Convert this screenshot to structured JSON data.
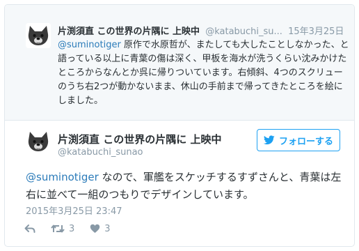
{
  "parent_tweet": {
    "name": "片渕須直 この世界の片隅に 上映中",
    "handle": "@katabuchi_su...",
    "date": "15年3月25日",
    "mention": "@suminotiger",
    "text": " 原作で水原哲が、またしても大したことしなかった、と語っている以上に青葉の傷は深く、甲板を海水が洗うくらい沈みかけたところからなんとか呉に帰りついています。右傾斜、4つのスクリューのうち右2つが動かないまま、休山の手前まで帰ってきたところを絵にしました。"
  },
  "main_tweet": {
    "name": "片渕須直 この世界の片隅に 上映中",
    "handle": "@katabuchi_sunao",
    "follow_label": "フォローする",
    "mention": "@suminotiger",
    "text": " なので、軍艦をスケッチするすずさんと、青葉は左右に並べて一組のつもりでデザインしています。",
    "timestamp": "2015年3月25日 23:47",
    "retweet_count": "3",
    "like_count": "3"
  },
  "colors": {
    "link": "#2b7bb9",
    "twitter_blue": "#1da1f2",
    "muted": "#8899a6",
    "parent_bg": "#f5f8fa"
  },
  "icons": [
    "avatar-dog",
    "twitter-bird-icon",
    "reply-icon",
    "retweet-icon",
    "heart-icon"
  ]
}
